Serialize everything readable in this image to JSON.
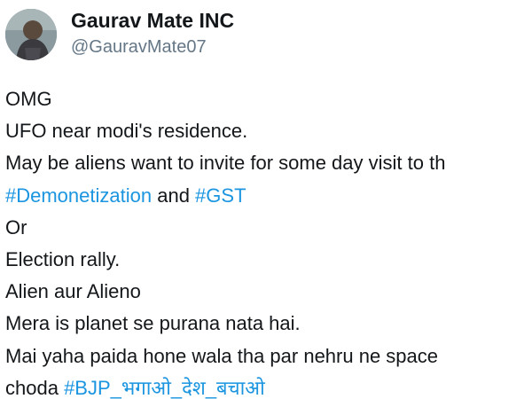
{
  "author": {
    "display_name": "Gaurav Mate INC",
    "handle": "@GauravMate07",
    "avatar_icon": "user-avatar-photo"
  },
  "tweet": {
    "lines": [
      "OMG",
      "UFO near modi's residence.",
      "May be aliens want to invite for some day visit to th",
      {
        "hashtag_1": "#Demonetization",
        "text": " and ",
        "hashtag_2": "#GST"
      },
      "Or",
      "Election rally.",
      "Alien aur Alieno",
      "Mera is planet se purana nata hai.",
      "Mai yaha paida hone wala tha par nehru ne space",
      {
        "text": "choda ",
        "hashtag_1": "#BJP_भगाओ_देश_बचाओ"
      }
    ]
  },
  "colors": {
    "text": "#14171a",
    "handle": "#657786",
    "hashtag": "#1b95e0",
    "background": "#ffffff"
  }
}
